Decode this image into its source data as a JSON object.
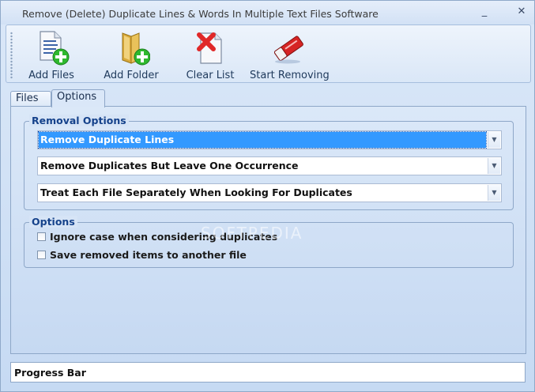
{
  "window": {
    "title": "Remove (Delete) Duplicate Lines & Words In Multiple Text Files Software",
    "minimize_glyph": "_",
    "close_glyph": "✕"
  },
  "toolbar": {
    "buttons": [
      {
        "label": "Add Files",
        "icon": "add-files-icon"
      },
      {
        "label": "Add Folder",
        "icon": "add-folder-icon"
      },
      {
        "label": "Clear List",
        "icon": "clear-list-icon"
      },
      {
        "label": "Start Removing",
        "icon": "eraser-icon"
      }
    ]
  },
  "tabs": [
    {
      "label": "Files",
      "active": false
    },
    {
      "label": "Options",
      "active": true
    }
  ],
  "removal_options": {
    "title": "Removal Options",
    "combos": [
      {
        "value": "Remove Duplicate Lines",
        "selected": true
      },
      {
        "value": "Remove Duplicates But Leave One Occurrence",
        "selected": false
      },
      {
        "value": "Treat Each File Separately When Looking For Duplicates",
        "selected": false
      }
    ]
  },
  "options": {
    "title": "Options",
    "checkboxes": [
      {
        "label": "Ignore case when considering duplicates",
        "checked": false
      },
      {
        "label": "Save removed items to another file",
        "checked": false
      }
    ]
  },
  "watermark": "SOFTPEDIA",
  "progress": {
    "label": "Progress Bar"
  },
  "colors": {
    "accent": "#15428b",
    "selection": "#3399ff",
    "toolbar_text": "#1e395b"
  }
}
